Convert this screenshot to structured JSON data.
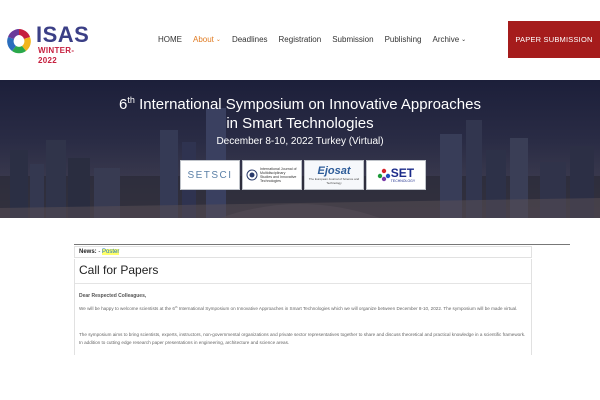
{
  "logo": {
    "name": "ISAS",
    "subtitle": "WINTER-2022",
    "colors": [
      "#c61f3e",
      "#f2b51c",
      "#2aa84a",
      "#2a6dbc",
      "#6a3a9a"
    ]
  },
  "nav": {
    "items": [
      {
        "label": "HOME",
        "active": false,
        "has_dropdown": false
      },
      {
        "label": "About",
        "active": true,
        "has_dropdown": true
      },
      {
        "label": "Deadlines",
        "active": false,
        "has_dropdown": false
      },
      {
        "label": "Registration",
        "active": false,
        "has_dropdown": false
      },
      {
        "label": "Submission",
        "active": false,
        "has_dropdown": false
      },
      {
        "label": "Publishing",
        "active": false,
        "has_dropdown": false
      },
      {
        "label": "Archive",
        "active": false,
        "has_dropdown": true
      }
    ],
    "dropdown_icon": "chevron-down-icon",
    "active_color": "#e07b22"
  },
  "paper_submission": {
    "label": "PAPER SUBMISSION",
    "color": "#a51c1c"
  },
  "hero": {
    "ordinal_number": "6",
    "ordinal_suffix": "th",
    "title_line1_rest": " International Symposium on Innovative Approaches",
    "title_line2": "in Smart Technologies",
    "date_line": "December 8-10, 2022 Turkey (Virtual)"
  },
  "sponsors": {
    "setsci": "SETSCI",
    "ijmsit": "International Journal of Multidisciplinary Studies and Innovative Technologies",
    "ejosat_main": "Ejosat",
    "ejosat_sub": "The European Journal of Science and Technology",
    "set_main": "SET",
    "set_sub": "TECHNOLOGY"
  },
  "news": {
    "label": "News:",
    "separator": " - ",
    "link": "Poster",
    "highlight_color": "#ffff6a"
  },
  "content": {
    "title": "Call for Papers",
    "greeting": "Dear Respected Colleagues,",
    "para1_before": "We will be happy to welcome scientists at the 6",
    "para1_sup": "th",
    "para1_after": " International Symposium on Innovative Approaches in Smart Technologies which we will organize between December 8-10, 2022. The symposium will be made virtual.",
    "para2": "The symposium aims to bring scientists, experts, instructors, non-governmental organizations and private sector representatives together to share and discuss theoretical and practical knowledge in a scientific framework. In addition to cutting edge research paper presentations in engineering, architecture and science areas."
  }
}
